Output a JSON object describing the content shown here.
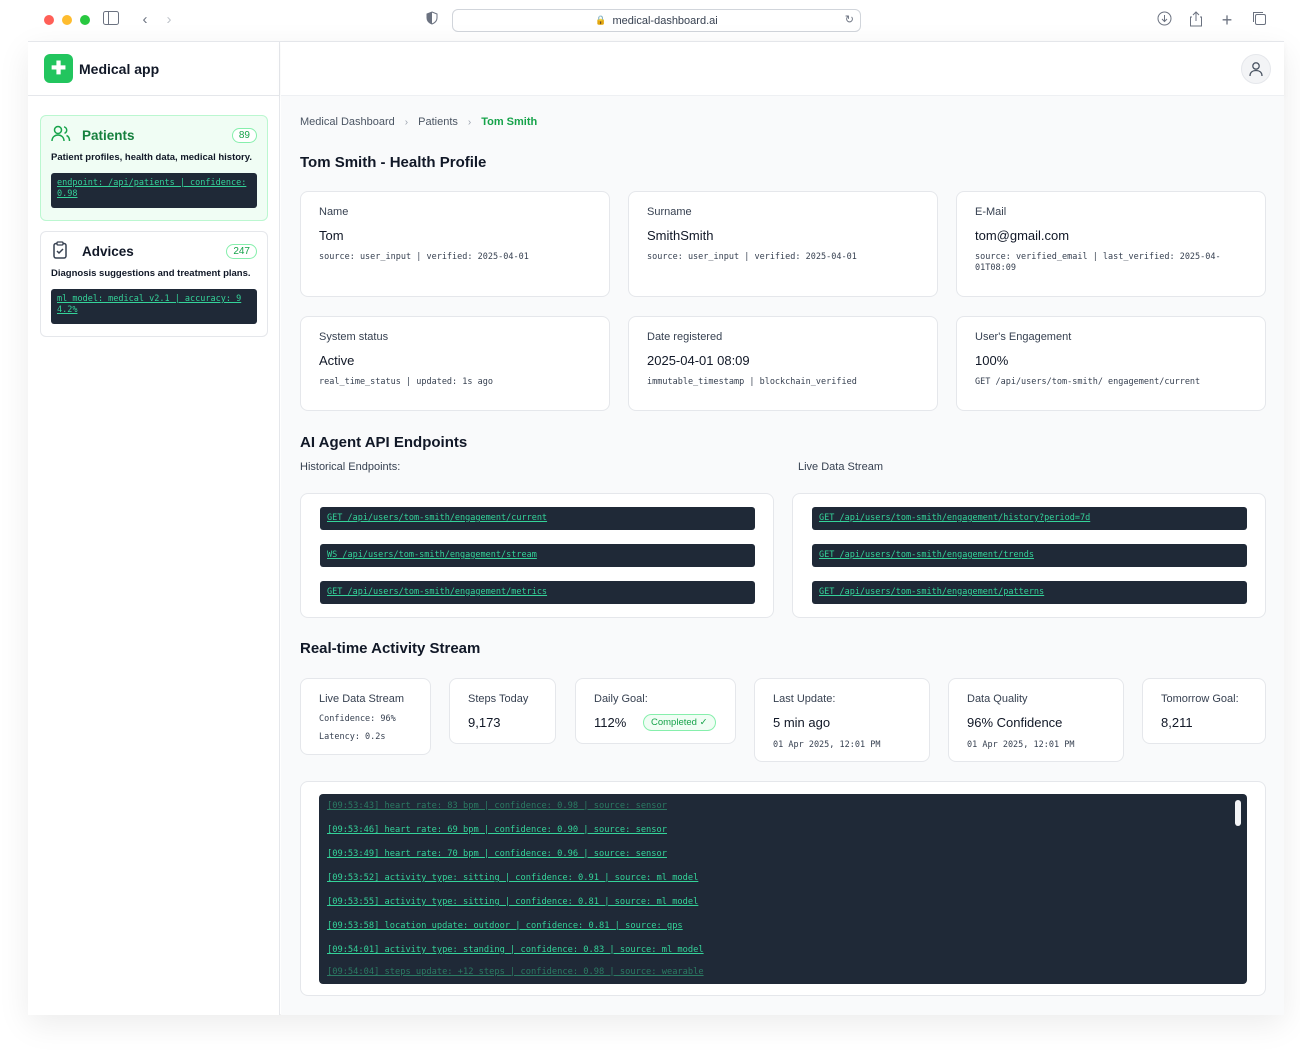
{
  "browser": {
    "url": "medical-dashboard.ai"
  },
  "brand": {
    "name": "Medical app"
  },
  "sidebar": {
    "items": [
      {
        "label": "Patients",
        "count": "89",
        "description": "Patient profiles, health data, medical history.",
        "code": "endpoint: /api/patients | confidence: 0.98"
      },
      {
        "label": "Advices",
        "count": "247",
        "description": "Diagnosis suggestions and treatment plans.",
        "code": "ml_model: medical_v2.1 | accuracy: 94.2%"
      }
    ]
  },
  "breadcrumb": [
    "Medical Dashboard",
    "Patients",
    "Tom Smith"
  ],
  "profile": {
    "title": "Tom Smith - Health Profile",
    "cards": [
      {
        "label": "Name",
        "value": "Tom",
        "meta": "source: user_input | verified: 2025-04-01"
      },
      {
        "label": "Surname",
        "value": "SmithSmith",
        "meta": "source: user_input | verified: 2025-04-01"
      },
      {
        "label": "E-Mail",
        "value": "tom@gmail.com",
        "meta": "source: verified_email | last_verified: 2025-04-01T08:09"
      },
      {
        "label": "System status",
        "value": "Active",
        "meta": "real_time_status | updated: 1s ago"
      },
      {
        "label": "Date registered",
        "value": "2025-04-01 08:09",
        "meta": "immutable_timestamp | blockchain_verified"
      },
      {
        "label": "User's Engagement",
        "value": "100%",
        "meta": "GET /api/users/tom-smith/ engagement/current"
      }
    ]
  },
  "api": {
    "title": "AI Agent API Endpoints",
    "historical_label": "Historical Endpoints:",
    "live_label": "Live Data Stream",
    "historical": [
      "GET /api/users/tom-smith/engagement/current",
      "WS /api/users/tom-smith/engagement/stream",
      "GET /api/users/tom-smith/engagement/metrics"
    ],
    "live": [
      "GET /api/users/tom-smith/engagement/history?period=7d",
      "GET /api/users/tom-smith/engagement/trends",
      "GET /api/users/tom-smith/engagement/patterns"
    ]
  },
  "activity": {
    "title": "Real-time Activity Stream",
    "stats": {
      "live": {
        "label": "Live Data Stream",
        "confidence": "Confidence: 96%",
        "latency": "Latency: 0.2s"
      },
      "steps": {
        "label": "Steps Today",
        "value": "9,173"
      },
      "daily": {
        "label": "Daily Goal:",
        "value": "112%",
        "badge": "Completed ✓"
      },
      "last": {
        "label": "Last Update:",
        "value": "5 min ago",
        "meta": "01 Apr 2025, 12:01 PM"
      },
      "quality": {
        "label": "Data Quality",
        "value": "96% Confidence",
        "meta": "01 Apr 2025, 12:01 PM"
      },
      "tomorrow": {
        "label": "Tomorrow Goal:",
        "value": "8,211"
      }
    },
    "logs": [
      "[09:53:43] heart_rate: 83 bpm | confidence: 0.98 | source: sensor",
      "[09:53:46] heart_rate: 69 bpm | confidence: 0.90 | source: sensor",
      "[09:53:49] heart_rate: 70 bpm | confidence: 0.96 | source: sensor",
      "[09:53:52] activity_type: sitting | confidence: 0.91 | source: ml_model",
      "[09:53:55] activity_type: sitting | confidence: 0.81 | source: ml_model",
      "[09:53:58] location_update: outdoor | confidence: 0.81 | source: gps",
      "[09:54:01] activity_type: standing | confidence: 0.83 | source: ml_model",
      "[09:54:04] steps_update: +12 steps | confidence: 0.98 | source: wearable"
    ]
  },
  "colors": {
    "accent": "#22c55e",
    "code_bg": "#1f2937",
    "code_text": "#34d399"
  }
}
